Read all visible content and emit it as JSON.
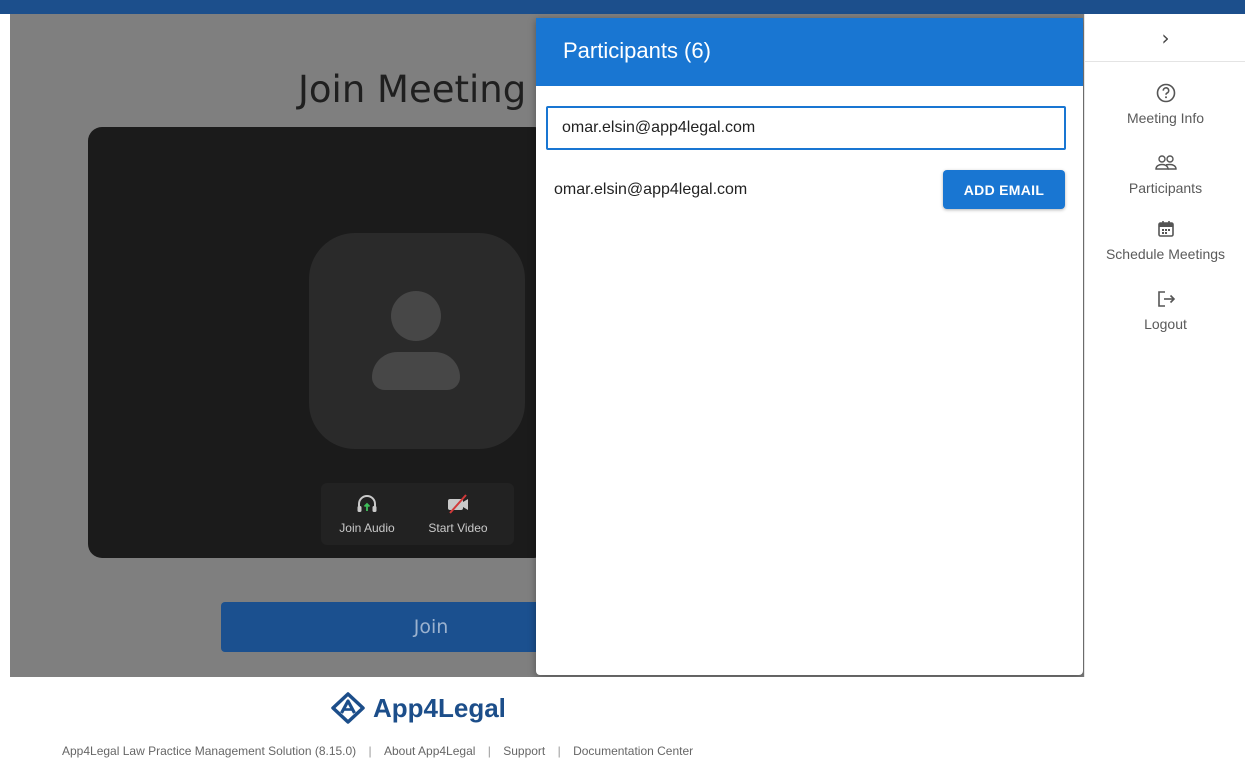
{
  "stage": {
    "title": "Join Meeting",
    "controls": {
      "join_audio_label": "Join Audio",
      "start_video_label": "Start Video"
    },
    "join_label": "Join"
  },
  "participants_panel": {
    "header": "Participants (6)",
    "email_input_value": "omar.elsin@app4legal.com",
    "suggestion_email": "omar.elsin@app4legal.com",
    "add_email_label": "ADD EMAIL"
  },
  "sidebar": {
    "collapse_icon": "chevron-right-icon",
    "items": [
      {
        "label": "Meeting Info",
        "icon": "help-circle-icon"
      },
      {
        "label": "Participants",
        "icon": "people-icon"
      },
      {
        "label": "Schedule Meetings",
        "icon": "calendar-icon"
      },
      {
        "label": "Logout",
        "icon": "logout-icon"
      }
    ]
  },
  "footer": {
    "logo_text": "App4Legal",
    "links": [
      "App4Legal Law Practice Management Solution (8.15.0)",
      "About App4Legal",
      "Support",
      "Documentation Center"
    ]
  },
  "colors": {
    "accent": "#1976d2",
    "top_bar": "#1c4f8c",
    "brand": "#1c4e8a"
  }
}
